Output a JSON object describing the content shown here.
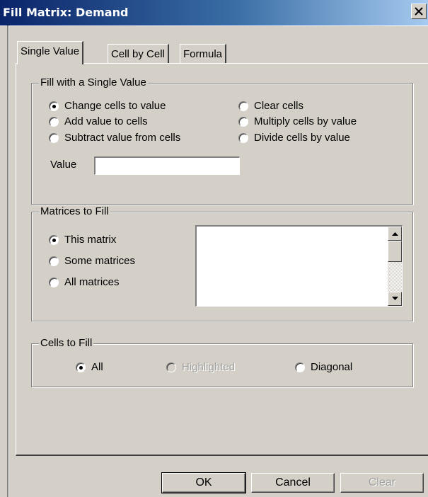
{
  "window": {
    "title": "Fill Matrix: Demand",
    "close_icon": "close-icon"
  },
  "tabs": [
    {
      "label": "Single Value",
      "active": true
    },
    {
      "label": "Cell by Cell",
      "active": false
    },
    {
      "label": "Formula",
      "active": false
    }
  ],
  "fill_single": {
    "legend": "Fill with a Single Value",
    "options": [
      {
        "label": "Change cells to value",
        "checked": true
      },
      {
        "label": "Add value to cells",
        "checked": false
      },
      {
        "label": "Subtract value from cells",
        "checked": false
      },
      {
        "label": "Clear cells",
        "checked": false
      },
      {
        "label": "Multiply cells by value",
        "checked": false
      },
      {
        "label": "Divide cells by value",
        "checked": false
      }
    ],
    "value_label": "Value",
    "value": ""
  },
  "matrices": {
    "legend": "Matrices to Fill",
    "options": [
      {
        "label": "This matrix",
        "checked": true
      },
      {
        "label": "Some matrices",
        "checked": false
      },
      {
        "label": "All matrices",
        "checked": false
      }
    ]
  },
  "cells": {
    "legend": "Cells to Fill",
    "options": [
      {
        "label": "All",
        "checked": true,
        "enabled": true
      },
      {
        "label": "Highlighted",
        "checked": false,
        "enabled": false
      },
      {
        "label": "Diagonal",
        "checked": false,
        "enabled": true
      }
    ]
  },
  "buttons": {
    "ok": "OK",
    "cancel": "Cancel",
    "clear": "Clear"
  }
}
